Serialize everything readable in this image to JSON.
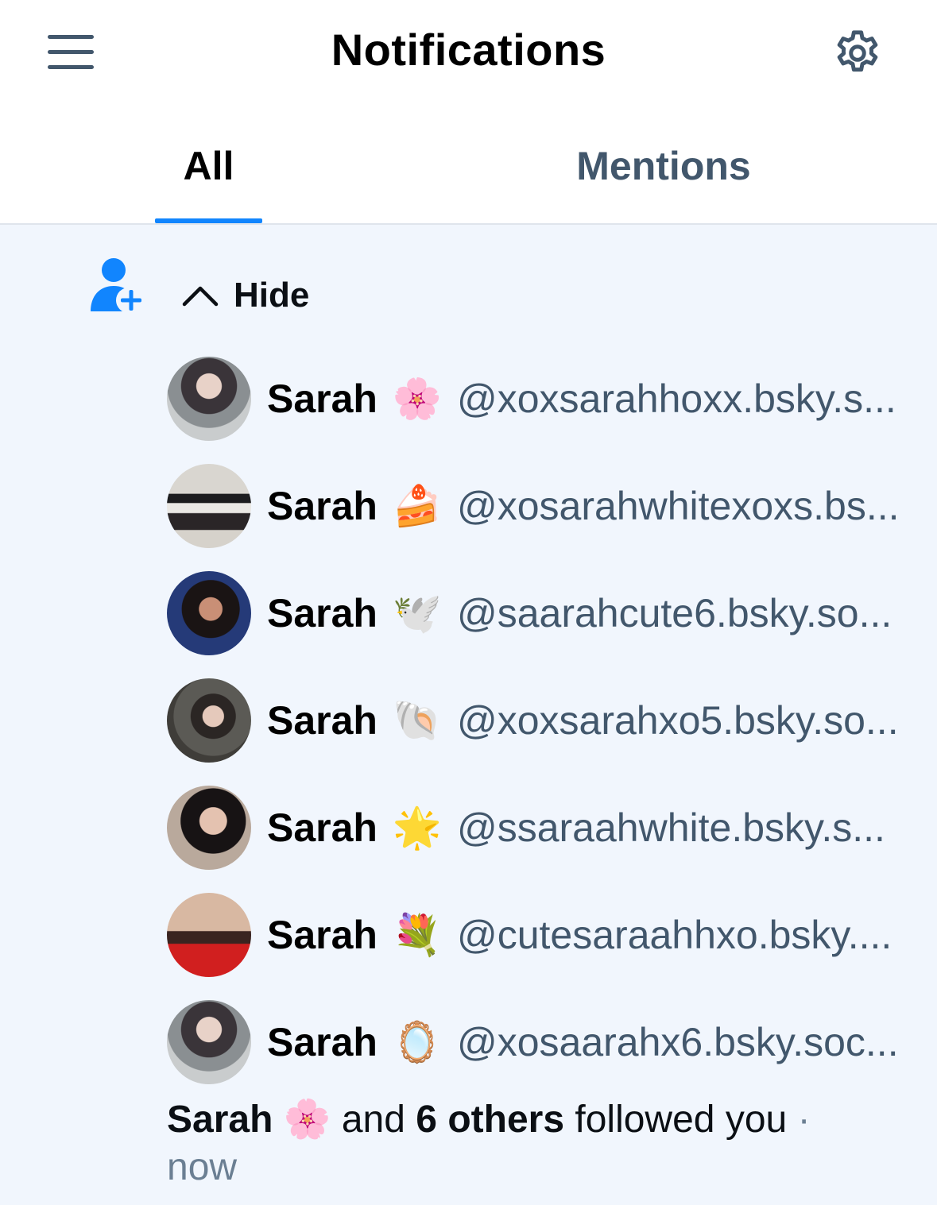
{
  "header": {
    "title": "Notifications",
    "menu_icon": "hamburger-menu-icon",
    "settings_icon": "gear-icon"
  },
  "tabs": [
    {
      "label": "All",
      "active": true
    },
    {
      "label": "Mentions",
      "active": false
    }
  ],
  "group": {
    "icon": "person-plus-icon",
    "hide_label": "Hide",
    "followers": [
      {
        "name": "Sarah",
        "emoji": "🌸",
        "handle": "@xoxsarahhoxx.bsky.s..."
      },
      {
        "name": "Sarah",
        "emoji": "🍰",
        "handle": "@xosarahwhitexoxs.bs..."
      },
      {
        "name": "Sarah",
        "emoji": "🕊️",
        "handle": "@saarahcute6.bsky.so..."
      },
      {
        "name": "Sarah",
        "emoji": "🐚",
        "handle": "@xoxsarahxo5.bsky.so..."
      },
      {
        "name": "Sarah",
        "emoji": "🌟",
        "handle": "@ssaraahwhite.bsky.s..."
      },
      {
        "name": "Sarah",
        "emoji": "💐",
        "handle": "@cutesaraahhxo.bsky...."
      },
      {
        "name": "Sarah",
        "emoji": "🪞",
        "handle": "@xosaarahx6.bsky.soc..."
      }
    ],
    "summary": {
      "first_name": "Sarah",
      "first_emoji": "🌸",
      "and": "and",
      "others": "6 others",
      "action": "followed you",
      "separator": "·",
      "time": "now"
    }
  },
  "colors": {
    "accent": "#1185fe",
    "muted": "#42576c",
    "panel_bg": "#f1f6fd"
  }
}
